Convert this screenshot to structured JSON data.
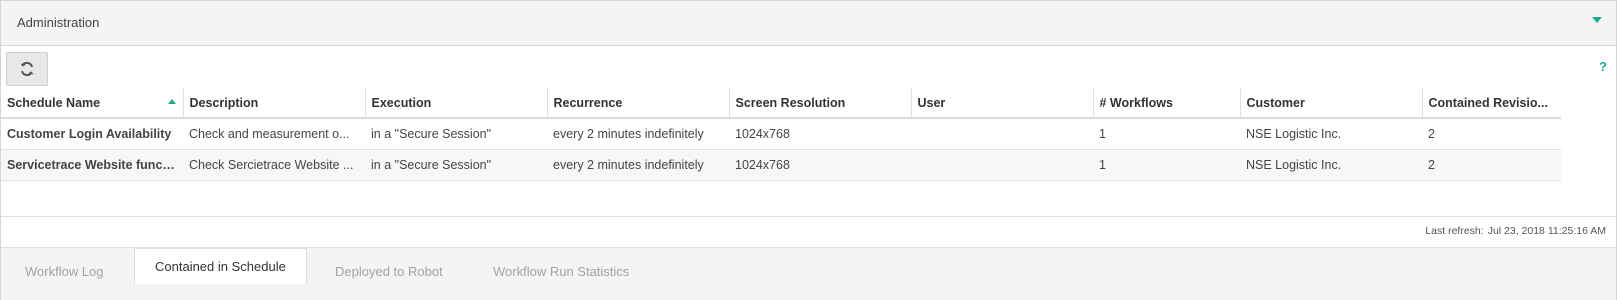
{
  "panel": {
    "title": "Administration"
  },
  "toolbar": {
    "help_label": "?"
  },
  "table": {
    "columns": [
      "Schedule Name",
      "Description",
      "Execution",
      "Recurrence",
      "Screen Resolution",
      "User",
      "# Workflows",
      "Customer",
      "Contained Revisio..."
    ],
    "sort_column": "Schedule Name",
    "sort_direction": "ascending",
    "rows": [
      {
        "name": "Customer Login Availability",
        "description": "Check and measurement o...",
        "execution": "in a \"Secure Session\"",
        "recurrence": "every 2 minutes indefinitely",
        "resolution": "1024x768",
        "user": "",
        "workflows": "1",
        "customer": "NSE Logistic Inc.",
        "revisions": "2"
      },
      {
        "name": "Servicetrace Website functio",
        "description": "Check Sercietrace Website ...",
        "execution": "in a \"Secure Session\"",
        "recurrence": "every 2 minutes indefinitely",
        "resolution": "1024x768",
        "user": "",
        "workflows": "1",
        "customer": "NSE Logistic Inc.",
        "revisions": "2"
      }
    ]
  },
  "status": {
    "last_refresh_label": "Last refresh:",
    "last_refresh_value": "Jul 23, 2018 11:25:16 AM"
  },
  "tabs": [
    {
      "label": "Workflow Log",
      "active": false
    },
    {
      "label": "Contained in Schedule",
      "active": true
    },
    {
      "label": "Deployed to Robot",
      "active": false
    },
    {
      "label": "Workflow Run Statistics",
      "active": false
    }
  ],
  "colors": {
    "accent": "#1fa88e",
    "link": "#2a6aa8"
  }
}
